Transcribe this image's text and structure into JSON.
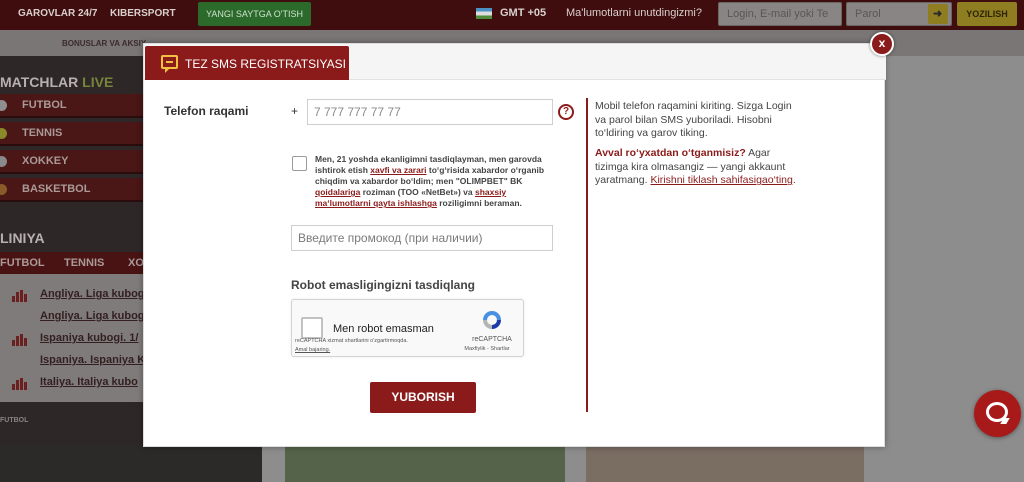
{
  "topbar": {
    "links": [
      "GAROVLAR 24/7",
      "KIBERSPORT"
    ],
    "green_button": "YANGI SAYTGA O'TISH",
    "timezone": "GMT +05",
    "forgot": "Ma'lumotlarni unutdingizmi?",
    "login_placeholder": "Login, E-mail yoki Te",
    "password_placeholder": "Parol",
    "register_label": "YOZILISH"
  },
  "subnav": {
    "text": "BONUSLAR VA AKSIY"
  },
  "sidebar": {
    "matches_heading": "MATCHLAR",
    "live_label": "LIVE",
    "sports": [
      "FUTBOL",
      "TENNIS",
      "XOKKEY",
      "BASKETBOL"
    ],
    "line_heading": "LINIYA",
    "tabs": [
      "FUTBOL",
      "TENNIS",
      "XO"
    ],
    "leagues": [
      "Angliya. Liga kubogi.",
      "Angliya. Liga kubogi",
      "Ispaniya kubogi. 1/",
      "Ispaniya. Ispaniya K",
      "Italiya. Italiya kubo"
    ],
    "futbol_strip": "FUTBOL"
  },
  "modal": {
    "tab_title": "TEZ SMS REGISTRATSIYASI",
    "close_label": "x",
    "phone_label": "Telefon raqami",
    "phone_prefix": "+",
    "phone_placeholder": "7 777 777 77 77",
    "help_label": "?",
    "agree": {
      "part1": "Men, 21 yoshda ekanligimni tasdiqlayman, men garovda ishtirok etish ",
      "link1": "xavfi va zarari",
      "part2": " to‘g‘risida xabardor o‘rganib chiqdim va xabardor bo‘ldim; men \"OLIMPBET\" BK ",
      "link2": "qoidalariga",
      "part3": " roziman (TOO «NetBet») va ",
      "link3": "shaxsiy ma‘lumotlarni qayta ishlashga",
      "part4": " roziligimni beraman."
    },
    "promo_placeholder": "Введите промокод (при наличии)",
    "robot_heading": "Robot emasligingizni tasdiqlang",
    "captcha": {
      "label": "Men robot emasman",
      "brand": "reCAPTCHA",
      "brand_links": "Maxfiylik - Shartlar",
      "note": "reCAPTCHA xizmat shartlarini o'zgartirmoqda.",
      "note_link": "Amal bajaring."
    },
    "submit_label": "YUBORISH",
    "info": "Mobil telefon raqamini kiriting. Sizga Login va parol bilan SMS yuboriladi. Hisobni to‘ldiring va garov tiking.",
    "already": {
      "question": "Avval ro‘yxatdan o‘tganmisiz?",
      "text": " Agar tizimga kira olmasangiz — yangi akkaunt yaratmang. ",
      "link": "Kirishni tiklash sahifasigao‘ting",
      "end": "."
    }
  },
  "colors": {
    "brand": "#8b1a1a",
    "accent_gold": "#f2c040",
    "chat": "#a81a1a"
  },
  "icons": [
    "sms-icon",
    "help-icon",
    "close-icon",
    "recaptcha-icon",
    "chat-icon",
    "login-enter-icon"
  ]
}
